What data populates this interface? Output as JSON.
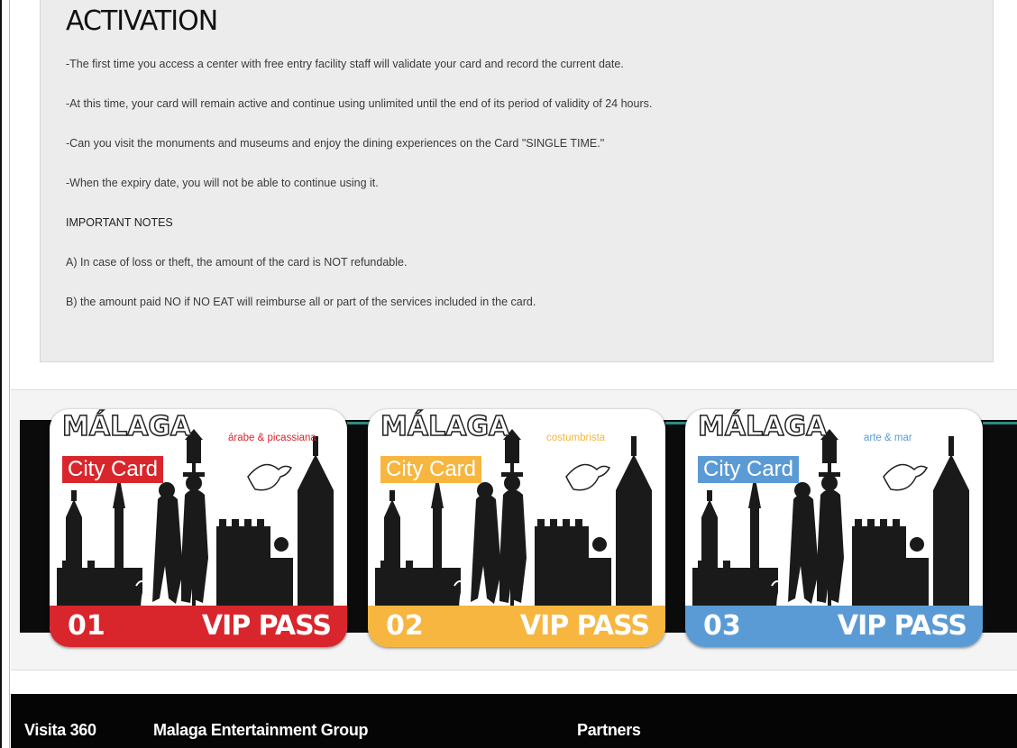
{
  "activation": {
    "title": "ACTIVATION",
    "paragraphs": [
      "-The first time you access a center with free entry facility staff will validate your card and record the current date.",
      "-At this time, your card will remain active and continue using unlimited until the end of its period of validity of 24 hours.",
      "-Can you visit the monuments and museums and enjoy the dining experiences on the Card \"SINGLE TIME.\"",
      "-When the expiry date, you will not be able to continue using it.",
      "IMPORTANT NOTES",
      "A) In case of loss or theft, the amount of the card is NOT refundable.",
      "B) the amount paid NO if NO EAT will reimburse all or part of the services included in the card."
    ]
  },
  "cards": [
    {
      "title": "MÁLAGA",
      "badge": "City Card",
      "subtitle": "árabe & picassiana",
      "number": "01",
      "vip": "VIP PASS",
      "color": "#d8262c"
    },
    {
      "title": "MÁLAGA",
      "badge": "City Card",
      "subtitle": "costumbrista",
      "number": "02",
      "vip": "VIP PASS",
      "color": "#f6b63f"
    },
    {
      "title": "MÁLAGA",
      "badge": "City Card",
      "subtitle": "arte & mar",
      "number": "03",
      "vip": "VIP PASS",
      "color": "#5b9bd5"
    }
  ],
  "footer": {
    "links": [
      "Visita 360",
      "Malaga Entertainment Group",
      "Partners"
    ]
  }
}
